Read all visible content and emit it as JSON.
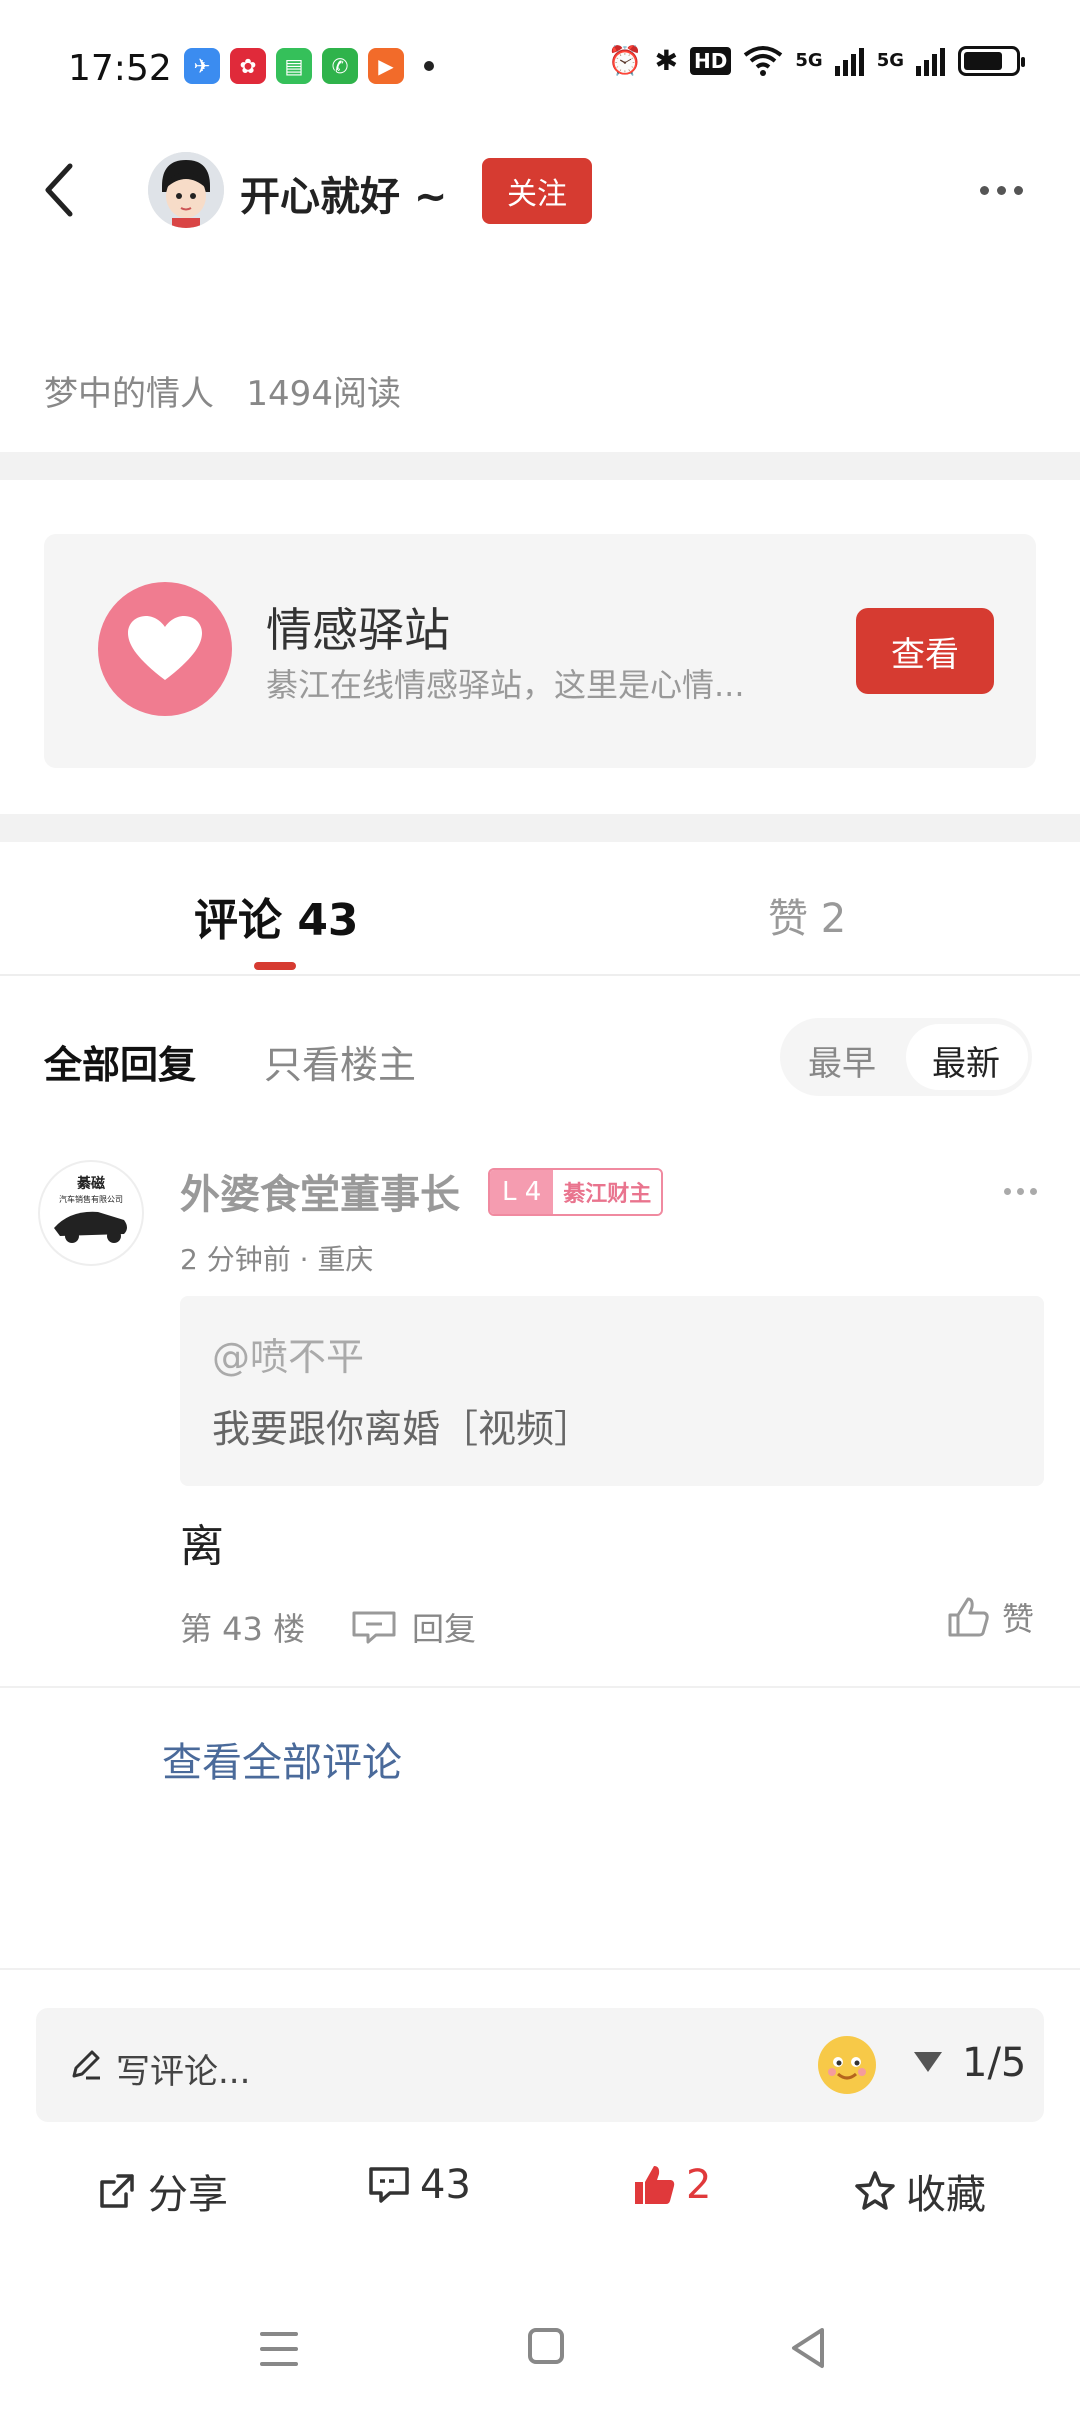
{
  "status_bar": {
    "time": "17:52",
    "apps": [
      "browser-icon",
      "red-app-icon",
      "messages-icon",
      "phone-icon",
      "video-icon"
    ],
    "right_icons": [
      "alarm-icon",
      "bluetooth-icon",
      "hd-icon",
      "wifi-icon",
      "signal-5g-icon",
      "signal-5g-icon",
      "battery-icon"
    ],
    "hd_label": "HD",
    "signal_label": "5G",
    "battery_level": 0.75
  },
  "header": {
    "user_name": "开心就好 ~",
    "follow_label": "关注"
  },
  "post_meta": "梦中的情人   1494阅读",
  "card": {
    "title": "情感驿站",
    "description": "綦江在线情感驿站，这里是心情...",
    "button_label": "查看",
    "accent": "#f07c90"
  },
  "tabs": {
    "comments_label": "评论 43",
    "likes_label": "赞 2"
  },
  "filters": {
    "all_label": "全部回复",
    "owner_label": "只看楼主",
    "sort_early": "最早",
    "sort_new": "最新"
  },
  "comment": {
    "user": "外婆食堂董事长",
    "level": "L 4",
    "title_badge": "綦江财主",
    "avatar_text": "綦磁",
    "avatar_sub": "汽车销售有限公司",
    "time": "2 分钟前 · 重庆",
    "quote_user": "@喷不平",
    "quote_text": "我要跟你离婚［视频］",
    "body": "离",
    "floor": "第 43 楼",
    "reply_label": "回复",
    "like_label": "赞"
  },
  "view_all_label": "查看全部评论",
  "input": {
    "placeholder": "写评论...",
    "page_indicator": "1/5"
  },
  "actions": {
    "share_label": "分享",
    "comment_count": "43",
    "like_count": "2",
    "favorite_label": "收藏"
  },
  "colors": {
    "brand_red": "#d63b31",
    "link_blue": "#4a6a9a"
  }
}
